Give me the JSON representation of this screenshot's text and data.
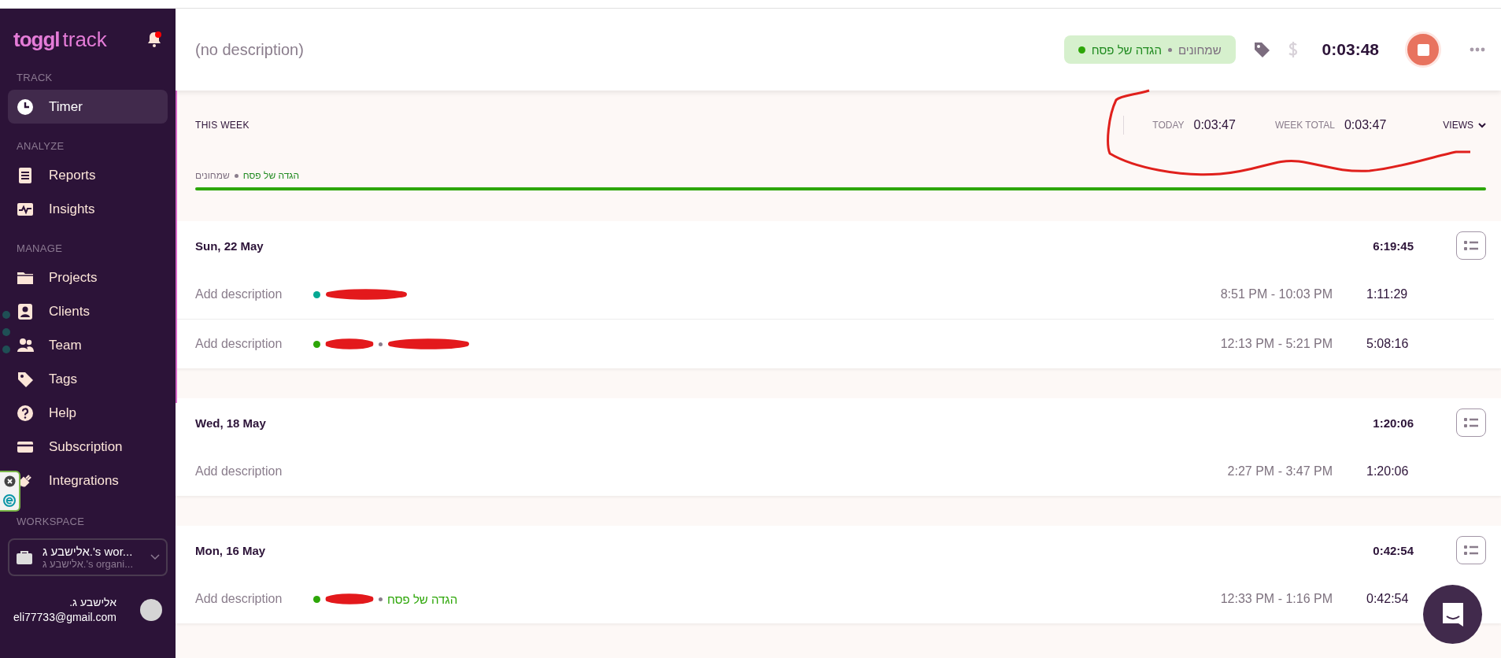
{
  "sidebar": {
    "logo": {
      "brand": "toggl",
      "product": "track"
    },
    "notifications": {
      "unread": true
    },
    "sections": [
      {
        "title": "TRACK",
        "items": [
          {
            "label": "Timer",
            "selected": true
          }
        ]
      },
      {
        "title": "ANALYZE",
        "items": [
          {
            "label": "Reports",
            "selected": false
          },
          {
            "label": "Insights",
            "selected": false
          }
        ]
      },
      {
        "title": "MANAGE",
        "items": [
          {
            "label": "Projects",
            "selected": false
          },
          {
            "label": "Clients",
            "selected": false
          },
          {
            "label": "Team",
            "selected": false
          },
          {
            "label": "Tags",
            "selected": false
          },
          {
            "label": "Help",
            "selected": false
          },
          {
            "label": "Subscription",
            "selected": false
          },
          {
            "label": "Integrations",
            "selected": false
          }
        ]
      }
    ],
    "workspace": {
      "title": "WORKSPACE",
      "name": "אלישבע ג.'s wor...",
      "organization": "אלישבע ג.'s organi..."
    },
    "user": {
      "name": "אלישבע ג.",
      "email": "eli77733@gmail.com"
    }
  },
  "timer_bar": {
    "description": "(no description)",
    "project": {
      "name": "הגדה של פסח",
      "client": "שמחונים",
      "color": "#2da608"
    },
    "billable": false,
    "elapsed": "0:03:48",
    "running": true
  },
  "week": {
    "title": "THIS WEEK",
    "today_label": "TODAY",
    "today_value": "0:03:47",
    "total_label": "WEEK TOTAL",
    "total_value": "0:03:47",
    "views": "VIEWS",
    "project": {
      "name": "הגדה של פסח",
      "client": "שמחונים",
      "color": "#2da608",
      "level": 1
    }
  },
  "annotations": [
    {
      "kind": "freehand-loop"
    }
  ],
  "days": [
    {
      "date": "Sun, 22 May",
      "total": "6:19:45",
      "entries": [
        {
          "placeholder": "Add description",
          "color": "#06a893",
          "segments": [
            {
              "kind": "redacted"
            }
          ],
          "time_range": "8:51 PM - 10:03 PM",
          "duration": "1:11:29"
        },
        {
          "placeholder": "Add description",
          "color": "#2da608",
          "segments": [
            {
              "kind": "redacted"
            },
            {
              "kind": "redacted"
            }
          ],
          "time_range": "12:13 PM - 5:21 PM",
          "duration": "5:08:16"
        }
      ]
    },
    {
      "date": "Wed, 18 May",
      "total": "1:20:06",
      "entries": [
        {
          "placeholder": "Add description",
          "time_range": "2:27 PM - 3:47 PM",
          "duration": "1:20:06"
        }
      ]
    },
    {
      "date": "Mon, 16 May",
      "total": "0:42:54",
      "entries": [
        {
          "placeholder": "Add description",
          "color": "#2da608",
          "segments": [
            {
              "kind": "redacted"
            },
            {
              "kind": "text",
              "text": "הגדה של פסח"
            }
          ],
          "time_range": "12:33 PM - 1:16 PM",
          "duration": "0:42:54"
        }
      ]
    }
  ]
}
